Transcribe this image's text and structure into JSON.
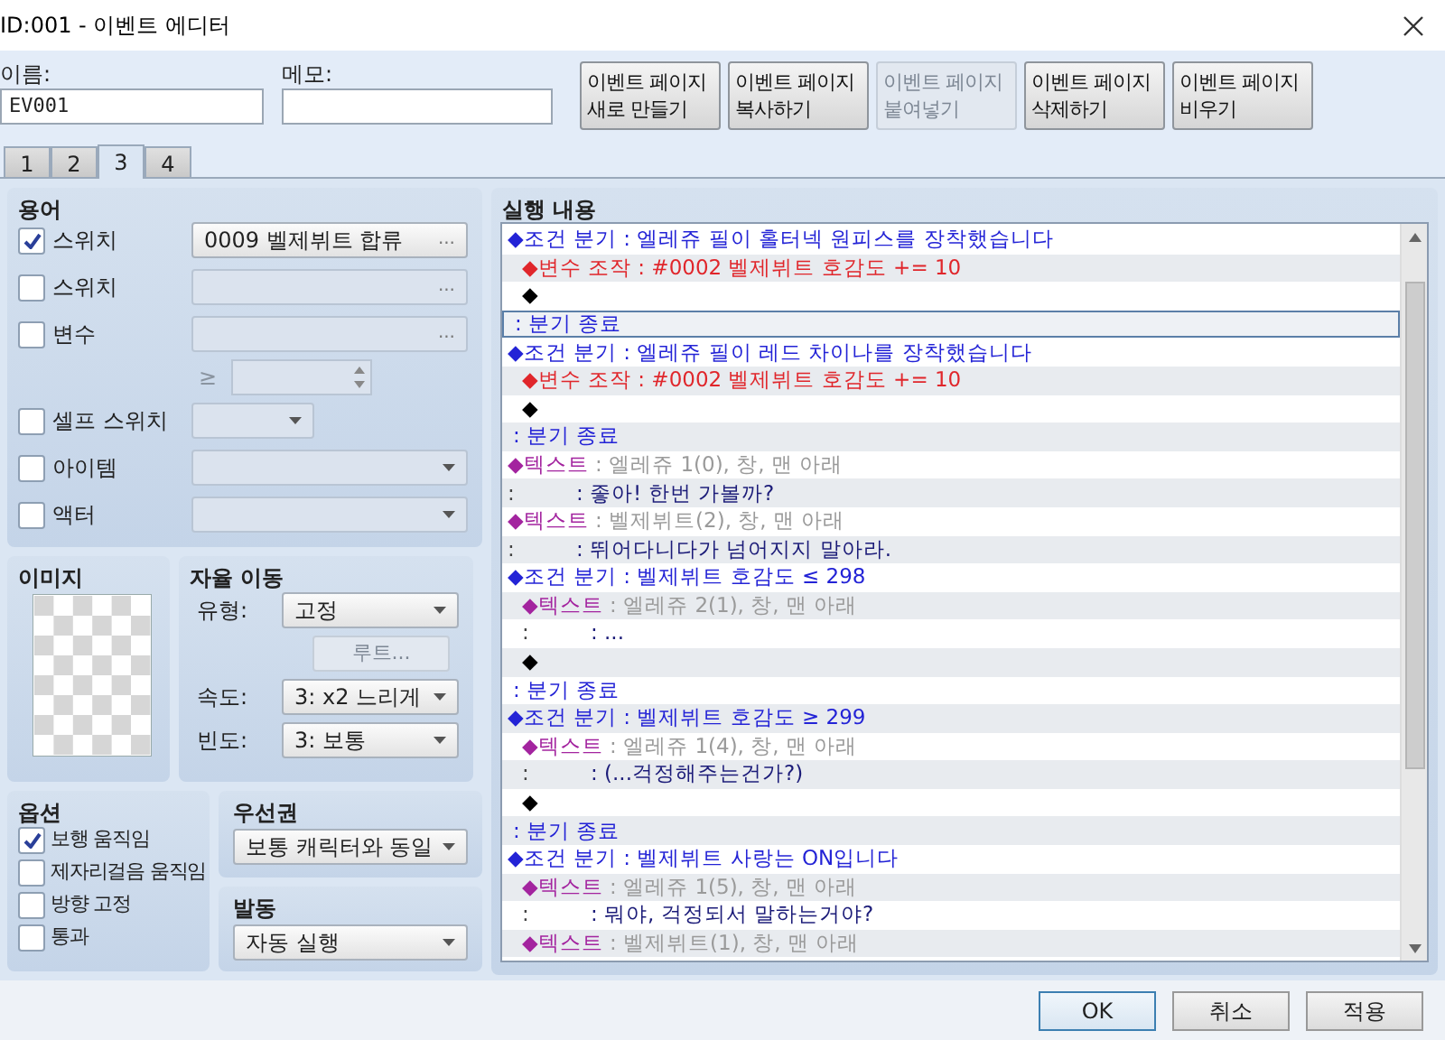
{
  "window": {
    "title": "ID:001 - 이벤트 에디터"
  },
  "name_field": {
    "label": "이름:",
    "value": "EV001"
  },
  "memo_field": {
    "label": "메모:"
  },
  "page_buttons": [
    {
      "lines": [
        "이벤트 페이지",
        "새로 만들기"
      ],
      "disabled": false
    },
    {
      "lines": [
        "이벤트 페이지",
        "복사하기"
      ],
      "disabled": false
    },
    {
      "lines": [
        "이벤트 페이지",
        "붙여넣기"
      ],
      "disabled": true
    },
    {
      "lines": [
        "이벤트 페이지",
        "삭제하기"
      ],
      "disabled": false
    },
    {
      "lines": [
        "이벤트 페이지",
        "비우기"
      ],
      "disabled": false
    }
  ],
  "tabs": [
    {
      "label": "1",
      "selected": false
    },
    {
      "label": "2",
      "selected": false
    },
    {
      "label": "3",
      "selected": true
    },
    {
      "label": "4",
      "selected": false
    }
  ],
  "conditions": {
    "title": "용어",
    "items": [
      {
        "kind": "picker",
        "label": "스위치",
        "checked": true,
        "value": "0009 벨제뷔트 합류",
        "button": "..."
      },
      {
        "kind": "picker",
        "label": "스위치",
        "checked": false,
        "button": "..."
      },
      {
        "kind": "picker",
        "label": "변수",
        "checked": false,
        "button": "..."
      },
      {
        "kind": "compare",
        "symbol": "≥"
      },
      {
        "kind": "small_dropdown",
        "label": "셀프 스위치",
        "checked": false
      },
      {
        "kind": "dropdown",
        "label": "아이템",
        "checked": false
      },
      {
        "kind": "dropdown",
        "label": "액터",
        "checked": false
      }
    ]
  },
  "image": {
    "title": "이미지"
  },
  "autonomous_movement": {
    "title": "자율 이동",
    "type": {
      "label": "유형:",
      "value": "고정"
    },
    "route_button": {
      "label": "루트...",
      "disabled": true
    },
    "speed": {
      "label": "속도:",
      "value": "3: x2 느리게"
    },
    "frequency": {
      "label": "빈도:",
      "value": "3: 보통"
    }
  },
  "options": {
    "title": "옵션",
    "items": [
      {
        "label": "보행 움직임",
        "checked": true
      },
      {
        "label": "제자리걸음 움직임",
        "checked": false
      },
      {
        "label": "방향 고정",
        "checked": false
      },
      {
        "label": "통과",
        "checked": false
      }
    ]
  },
  "priority": {
    "title": "우선권",
    "value": "보통 캐릭터와 동일"
  },
  "trigger": {
    "title": "발동",
    "value": "자동 실행"
  },
  "contents": {
    "title": "실행 내용",
    "rows": [
      {
        "kind": "branch",
        "label": "◆조건 분기",
        "detail": ": 엘레쥬 필이 홀터넥 원피스를 장착했습니다",
        "selected": false,
        "children": [
          {
            "kind": "variable",
            "label": "◆변수 조작",
            "detail": ": #0002 벨제뷔트 호감도 += 10",
            "selected": false
          },
          {
            "kind": "empty",
            "label": "◆",
            "selected": false
          }
        ]
      },
      {
        "kind": "end",
        "label": ": 분기 종료",
        "selected": true
      },
      {
        "kind": "branch",
        "label": "◆조건 분기",
        "detail": ": 엘레쥬 필이 레드 차이나를 장착했습니다",
        "selected": false,
        "children": [
          {
            "kind": "variable",
            "label": "◆변수 조작",
            "detail": ": #0002 벨제뷔트 호감도 += 10",
            "selected": false
          },
          {
            "kind": "empty",
            "label": "◆",
            "selected": false
          }
        ]
      },
      {
        "kind": "end",
        "label": ": 분기 종료",
        "selected": false
      },
      {
        "kind": "text",
        "label": "◆텍스트",
        "detail": ": 엘레쥬 1(0), 창, 맨 아래",
        "selected": false
      },
      {
        "kind": "continuation",
        "label": ":",
        "detail": ": 좋아! 한번 가볼까?",
        "selected": false
      },
      {
        "kind": "text",
        "label": "◆텍스트",
        "detail": ": 벨제뷔트(2), 창, 맨 아래",
        "selected": false
      },
      {
        "kind": "continuation",
        "label": ":",
        "detail": ": 뛰어다니다가 넘어지지 말아라.",
        "selected": false
      },
      {
        "kind": "branch",
        "label": "◆조건 분기",
        "detail": ": 벨제뷔트 호감도 ≤ 298",
        "selected": false,
        "children": [
          {
            "kind": "text",
            "label": "◆텍스트",
            "detail": ": 엘레쥬 2(1), 창, 맨 아래",
            "selected": false
          },
          {
            "kind": "continuation",
            "label": ":",
            "detail": ": ...",
            "selected": false
          },
          {
            "kind": "empty",
            "label": "◆",
            "selected": false
          }
        ]
      },
      {
        "kind": "end",
        "label": ": 분기 종료",
        "selected": false
      },
      {
        "kind": "branch",
        "label": "◆조건 분기",
        "detail": ": 벨제뷔트 호감도 ≥ 299",
        "selected": false,
        "children": [
          {
            "kind": "text",
            "label": "◆텍스트",
            "detail": ": 엘레쥬 1(4), 창, 맨 아래",
            "selected": false
          },
          {
            "kind": "continuation",
            "label": ":",
            "detail": ": (...걱정해주는건가?)",
            "selected": false
          },
          {
            "kind": "empty",
            "label": "◆",
            "selected": false
          }
        ]
      },
      {
        "kind": "end",
        "label": ": 분기 종료",
        "selected": false
      },
      {
        "kind": "branch",
        "label": "◆조건 분기",
        "detail": ": 벨제뷔트 사랑는 ON입니다",
        "selected": false,
        "children": [
          {
            "kind": "text",
            "label": "◆텍스트",
            "detail": ": 엘레쥬 1(5), 창, 맨 아래",
            "selected": false
          },
          {
            "kind": "continuation",
            "label": ":",
            "detail": ": 뭐야, 걱정되서 말하는거야?",
            "selected": false
          },
          {
            "kind": "text",
            "label": "◆텍스트",
            "detail": ": 벨제뷔트(1), 창, 맨 아래",
            "selected": false
          }
        ]
      }
    ]
  },
  "dialog_buttons": [
    {
      "label": "OK",
      "default": true
    },
    {
      "label": "취소",
      "default": false
    },
    {
      "label": "적용",
      "default": false
    }
  ]
}
